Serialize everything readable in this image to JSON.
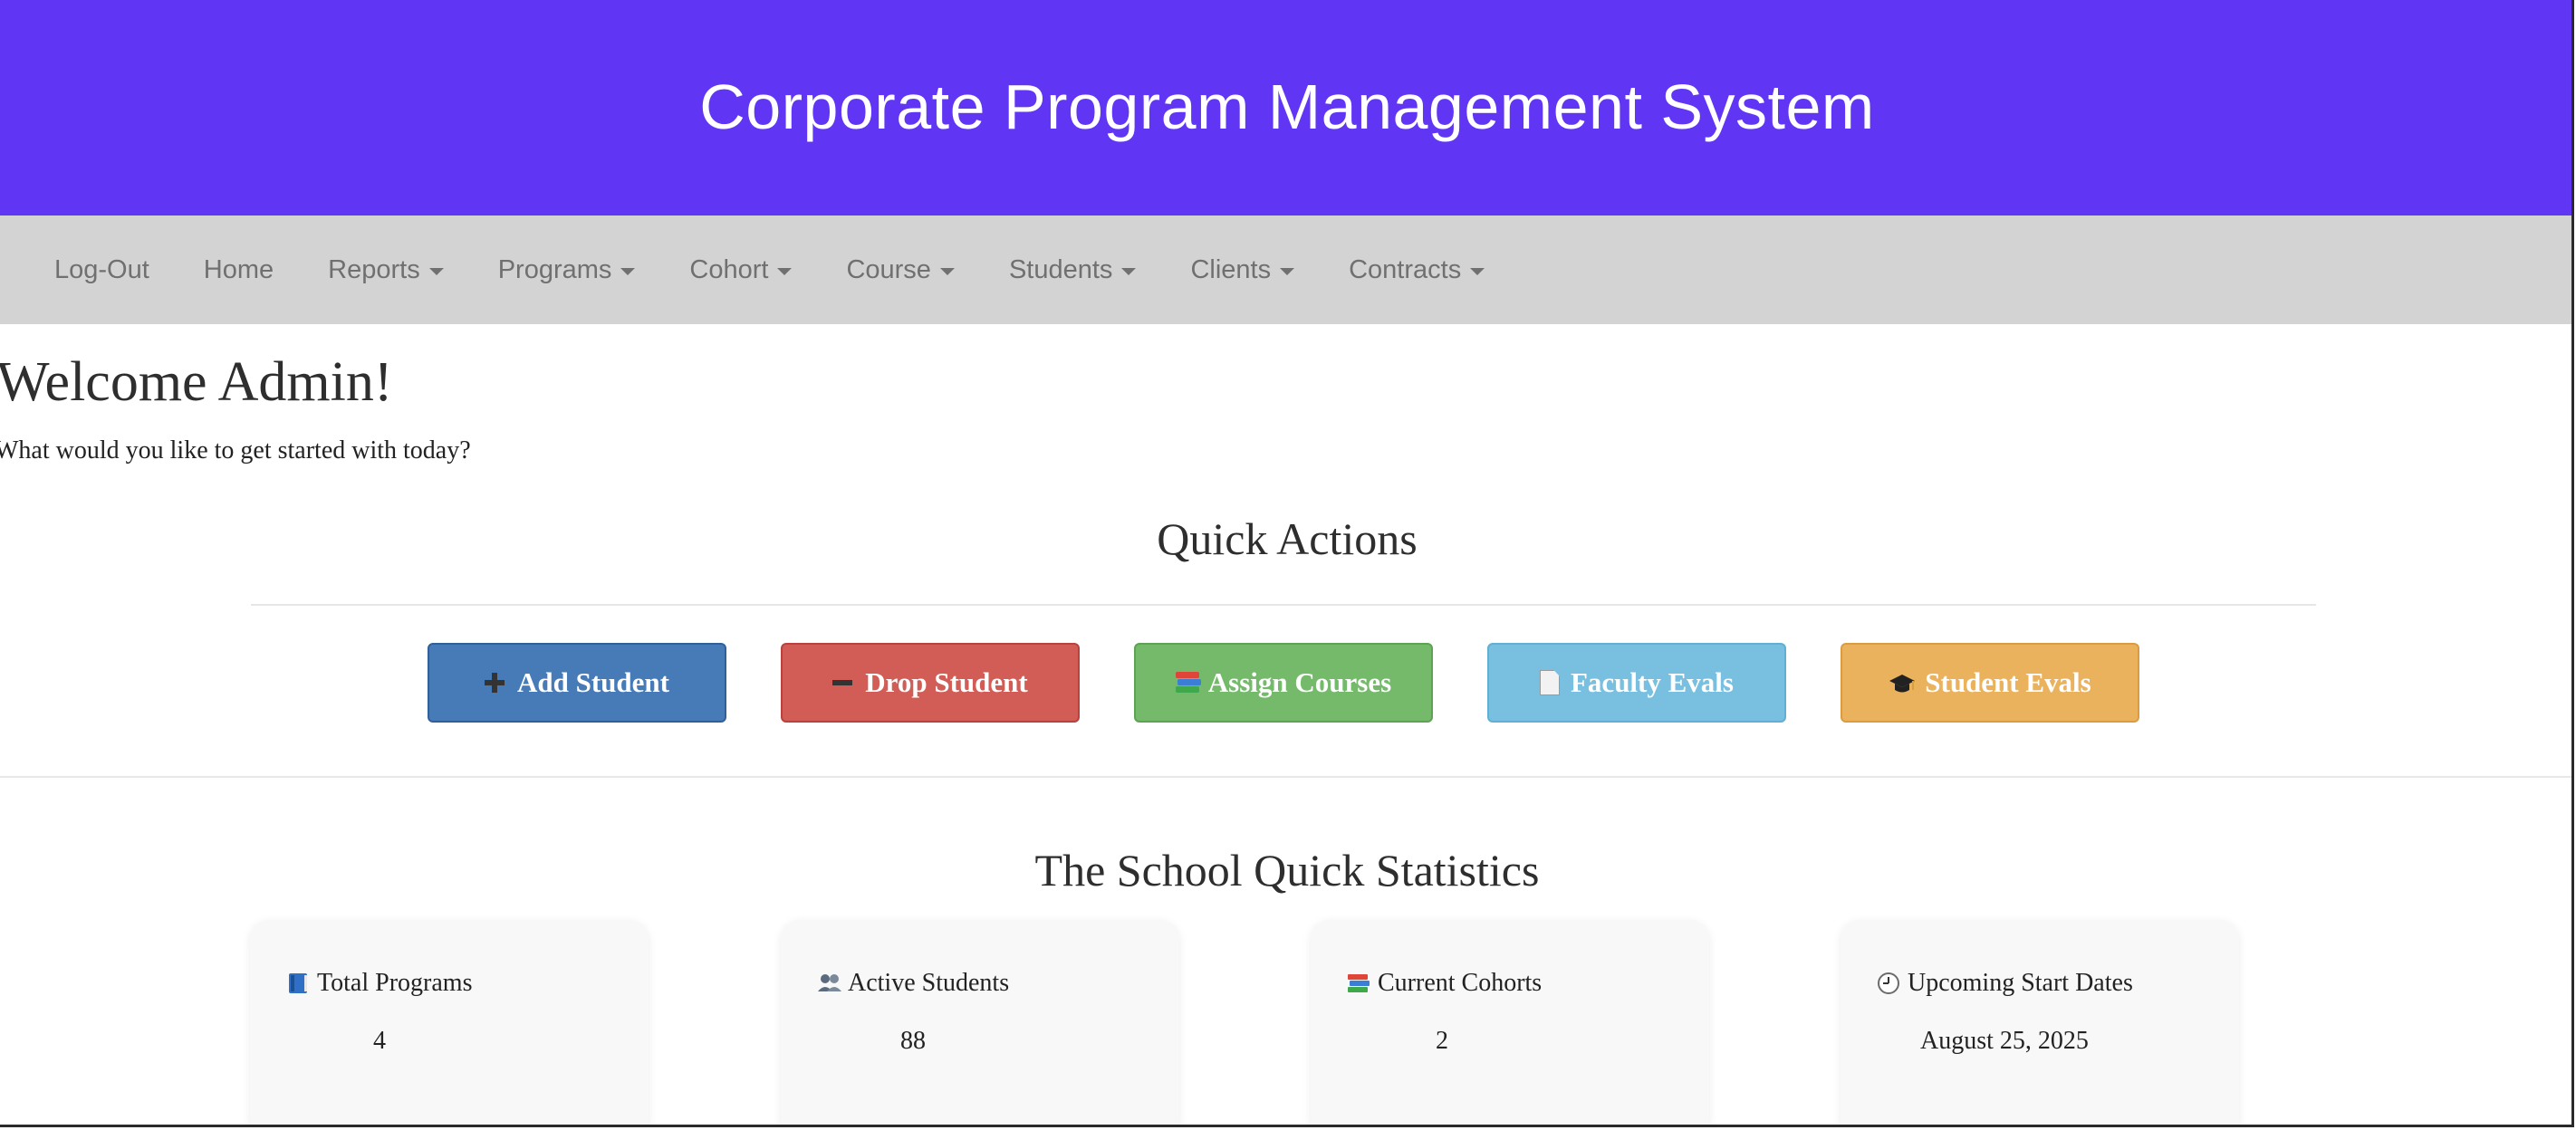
{
  "header": {
    "title": "Corporate Program Management System"
  },
  "nav": {
    "items": [
      {
        "label": "Log-Out",
        "dropdown": false
      },
      {
        "label": "Home",
        "dropdown": false
      },
      {
        "label": "Reports",
        "dropdown": true
      },
      {
        "label": "Programs",
        "dropdown": true
      },
      {
        "label": "Cohort",
        "dropdown": true
      },
      {
        "label": "Course",
        "dropdown": true
      },
      {
        "label": "Students",
        "dropdown": true
      },
      {
        "label": "Clients",
        "dropdown": true
      },
      {
        "label": "Contracts",
        "dropdown": true
      }
    ]
  },
  "welcome": {
    "title": "Welcome Admin!",
    "subtitle": "What would you like to get started with today?"
  },
  "quick_actions": {
    "title": "Quick Actions",
    "buttons": [
      {
        "label": "Add Student",
        "icon": "plus-icon",
        "color": "#477bb8"
      },
      {
        "label": "Drop Student",
        "icon": "minus-icon",
        "color": "#d25d56"
      },
      {
        "label": "Assign Courses",
        "icon": "books-icon",
        "color": "#74ba6a"
      },
      {
        "label": "Faculty Evals",
        "icon": "document-icon",
        "color": "#78bfe0"
      },
      {
        "label": "Student Evals",
        "icon": "graduation-cap-icon",
        "color": "#ebb25e"
      }
    ]
  },
  "statistics": {
    "title": "The School Quick Statistics",
    "cards": [
      {
        "label": "Total Programs",
        "value": "4",
        "icon": "blue-book-icon"
      },
      {
        "label": "Active Students",
        "value": "88",
        "icon": "people-icon"
      },
      {
        "label": "Current Cohorts",
        "value": "2",
        "icon": "books-icon"
      },
      {
        "label": "Upcoming Start Dates",
        "value": "August 25, 2025",
        "icon": "clock-icon"
      }
    ]
  },
  "colors": {
    "banner": "#6036f4",
    "navbar": "#d3d3d3"
  }
}
